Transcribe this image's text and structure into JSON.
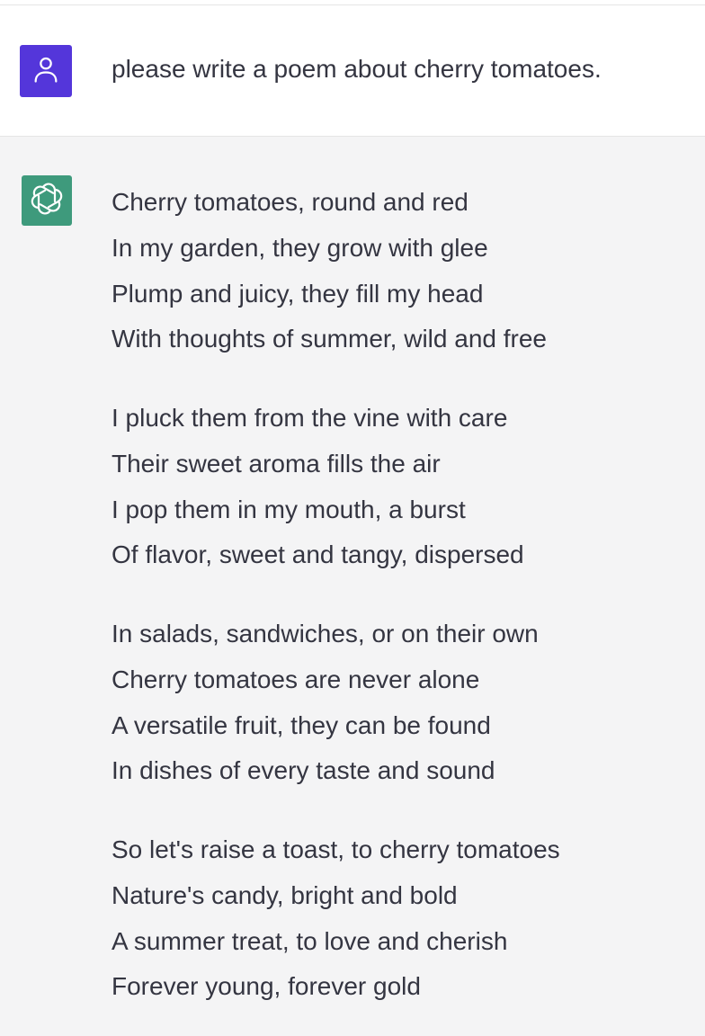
{
  "conversation": {
    "user_message": {
      "avatar_icon": "user-icon",
      "avatar_color": "#5436da",
      "text": "please write a poem about cherry tomatoes."
    },
    "assistant_message": {
      "avatar_icon": "openai-logo-icon",
      "avatar_color": "#3e9a7c",
      "stanzas": [
        {
          "lines": [
            "Cherry tomatoes, round and red",
            "In my garden, they grow with glee",
            "Plump and juicy, they fill my head",
            "With thoughts of summer, wild and free"
          ]
        },
        {
          "lines": [
            "I pluck them from the vine with care",
            "Their sweet aroma fills the air",
            "I pop them in my mouth, a burst",
            "Of flavor, sweet and tangy, dispersed"
          ]
        },
        {
          "lines": [
            "In salads, sandwiches, or on their own",
            "Cherry tomatoes are never alone",
            "A versatile fruit, they can be found",
            "In dishes of every taste and sound"
          ]
        },
        {
          "lines": [
            "So let's raise a toast, to cherry tomatoes",
            "Nature's candy, bright and bold",
            "A summer treat, to love and cherish",
            "Forever young, forever gold"
          ]
        }
      ]
    }
  }
}
